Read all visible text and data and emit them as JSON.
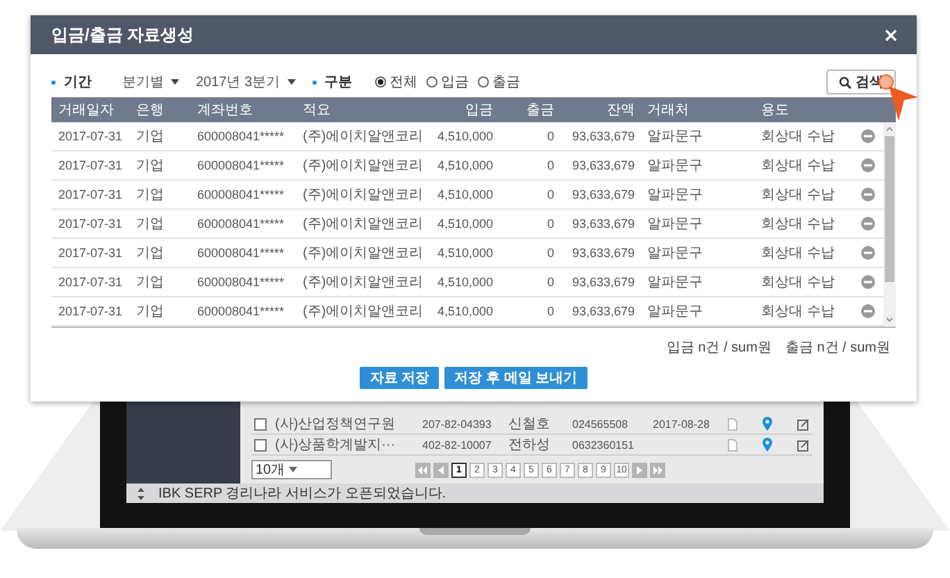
{
  "dialog": {
    "title": "입금/출금 자료생성",
    "filters": {
      "period_label": "기간",
      "period_type": "분기별",
      "period_value": "2017년 3분기",
      "type_label": "구분",
      "type_options": [
        {
          "label": "전체",
          "selected": true
        },
        {
          "label": "입금",
          "selected": false
        },
        {
          "label": "출금",
          "selected": false
        }
      ]
    },
    "search_button": "검색",
    "table": {
      "columns": [
        "거래일자",
        "은행",
        "계좌번호",
        "적요",
        "입금",
        "출금",
        "잔액",
        "거래처",
        "용도"
      ],
      "rows": [
        {
          "cells": [
            "2017-07-31",
            "기업",
            "600008041*****",
            "(주)에이치알앤코리",
            "4,510,000",
            "0",
            "93,633,679",
            "알파문구",
            "회상대 수납"
          ]
        },
        {
          "cells": [
            "2017-07-31",
            "기업",
            "600008041*****",
            "(주)에이치알앤코리",
            "4,510,000",
            "0",
            "93,633,679",
            "알파문구",
            "회상대 수납"
          ]
        },
        {
          "cells": [
            "2017-07-31",
            "기업",
            "600008041*****",
            "(주)에이치알앤코리",
            "4,510,000",
            "0",
            "93,633,679",
            "알파문구",
            "회상대 수납"
          ]
        },
        {
          "cells": [
            "2017-07-31",
            "기업",
            "600008041*****",
            "(주)에이치알앤코리",
            "4,510,000",
            "0",
            "93,633,679",
            "알파문구",
            "회상대 수납"
          ]
        },
        {
          "cells": [
            "2017-07-31",
            "기업",
            "600008041*****",
            "(주)에이치알앤코리",
            "4,510,000",
            "0",
            "93,633,679",
            "알파문구",
            "회상대 수납"
          ]
        },
        {
          "cells": [
            "2017-07-31",
            "기업",
            "600008041*****",
            "(주)에이치알앤코리",
            "4,510,000",
            "0",
            "93,633,679",
            "알파문구",
            "회상대 수납"
          ]
        },
        {
          "cells": [
            "2017-07-31",
            "기업",
            "600008041*****",
            "(주)에이치알앤코리",
            "4,510,000",
            "0",
            "93,633,679",
            "알파문구",
            "회상대 수납"
          ]
        }
      ]
    },
    "summary": {
      "deposit": "입금 n건 / sum원",
      "withdrawal": "출금 n건 / sum원"
    },
    "buttons": [
      "자료 저장",
      "저장 후 메일 보내기"
    ]
  },
  "background_app": {
    "rows": [
      {
        "checked": false,
        "company": "(사)산업정책연구원",
        "business_no": "207-82-04393",
        "name": "신철호",
        "phone": "024565508",
        "date": "2017-08-28"
      },
      {
        "checked": false,
        "company": "(사)상품학계발지···",
        "business_no": "402-82-10007",
        "name": "전하성",
        "phone": "0632360151"
      }
    ],
    "page_size": "10개",
    "pages": [
      {
        "label": "1",
        "selected": true
      },
      {
        "label": "2",
        "selected": false
      },
      {
        "label": "3",
        "selected": false
      },
      {
        "label": "4",
        "selected": false
      },
      {
        "label": "5",
        "selected": false
      },
      {
        "label": "6",
        "selected": false
      },
      {
        "label": "7",
        "selected": false
      },
      {
        "label": "8",
        "selected": false
      },
      {
        "label": "9",
        "selected": false
      },
      {
        "label": "10",
        "selected": false
      }
    ],
    "notice": "IBK SERP 경리나라 서비스가 오픈되었습니다."
  }
}
